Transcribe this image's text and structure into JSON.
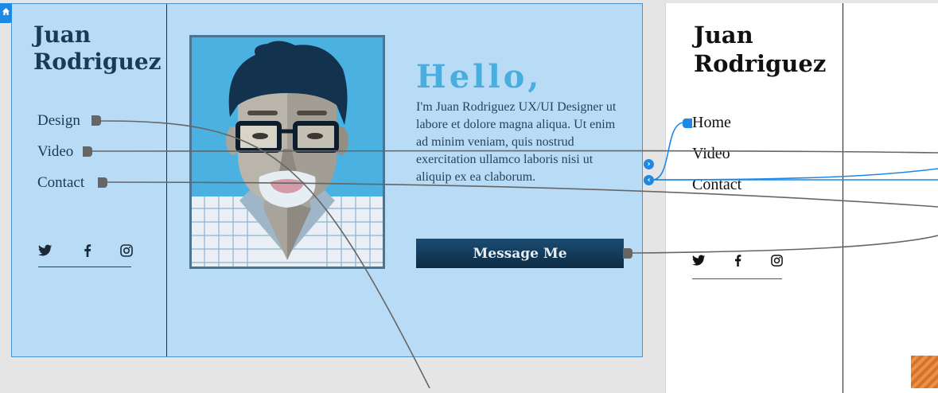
{
  "artboard_1": {
    "name": "Juan Rodriguez",
    "name_line1": "Juan",
    "name_line2": "Rodriguez",
    "nav": [
      "Design",
      "Video",
      "Contact"
    ],
    "social": [
      "twitter-icon",
      "facebook-icon",
      "instagram-icon"
    ],
    "hello": "Hello,",
    "bio": "I'm Juan Rodriguez UX/UI Designer ut labore et dolore magna aliqua. Ut enim ad minim veniam, quis nostrud exercitation ullamco laboris nisi ut aliquip ex ea claborum.",
    "cta": "Message Me",
    "background_color": "#b8dcf5",
    "accent_color": "#4aaddf"
  },
  "artboard_2": {
    "name_line1": "Juan",
    "name_line2": "Rodriguez",
    "nav": [
      "Home",
      "Video",
      "Contact"
    ],
    "social": [
      "twitter-icon",
      "facebook-icon",
      "instagram-icon"
    ],
    "background_color": "#ffffff"
  },
  "prototype": {
    "link_color": "#666666",
    "selected_link_color": "#1e88e5",
    "home_icon": "home-icon",
    "flow_badges": [
      "chevron-right-icon",
      "chevron-left-icon"
    ]
  }
}
